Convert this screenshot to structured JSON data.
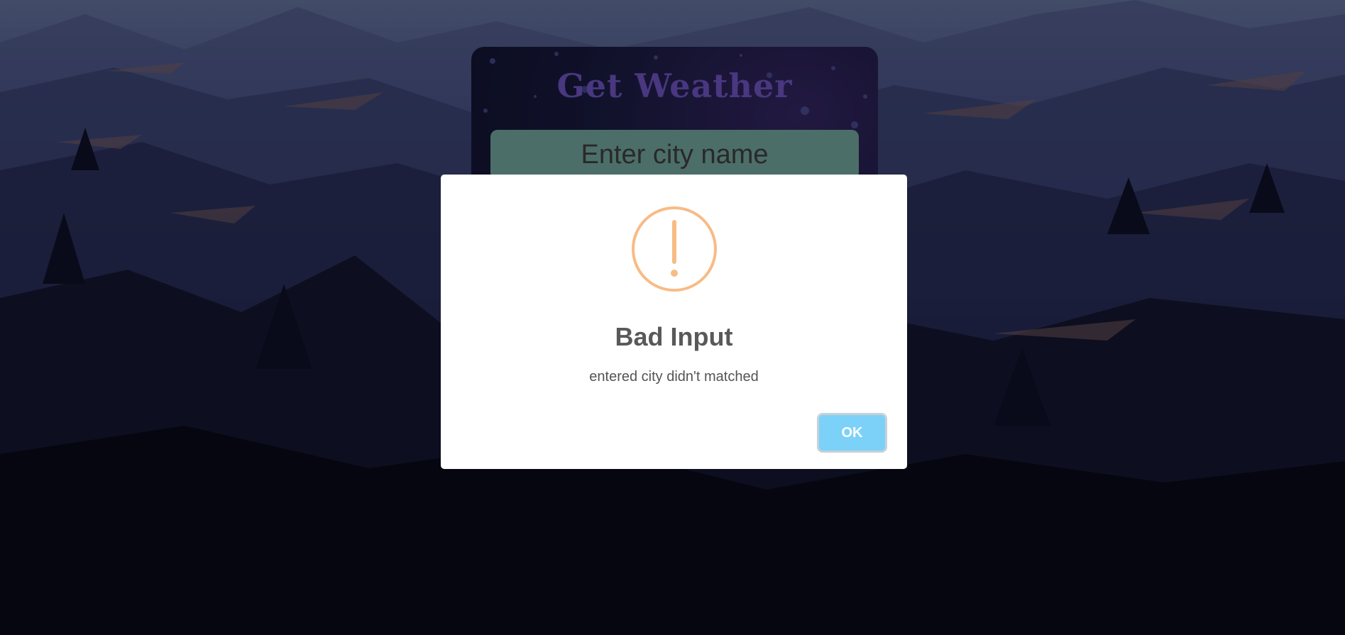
{
  "app": {
    "title": "Get Weather",
    "search": {
      "placeholder": "Enter city name",
      "value": ""
    }
  },
  "alert": {
    "icon": "warning-exclamation-icon",
    "title": "Bad Input",
    "message": "entered city didn't matched",
    "confirm_label": "OK"
  },
  "colors": {
    "title": "#7a5cd6",
    "input_bg": "#7fb7ad",
    "warning": "#f8bb86",
    "ok_button": "#7cd1f9"
  }
}
